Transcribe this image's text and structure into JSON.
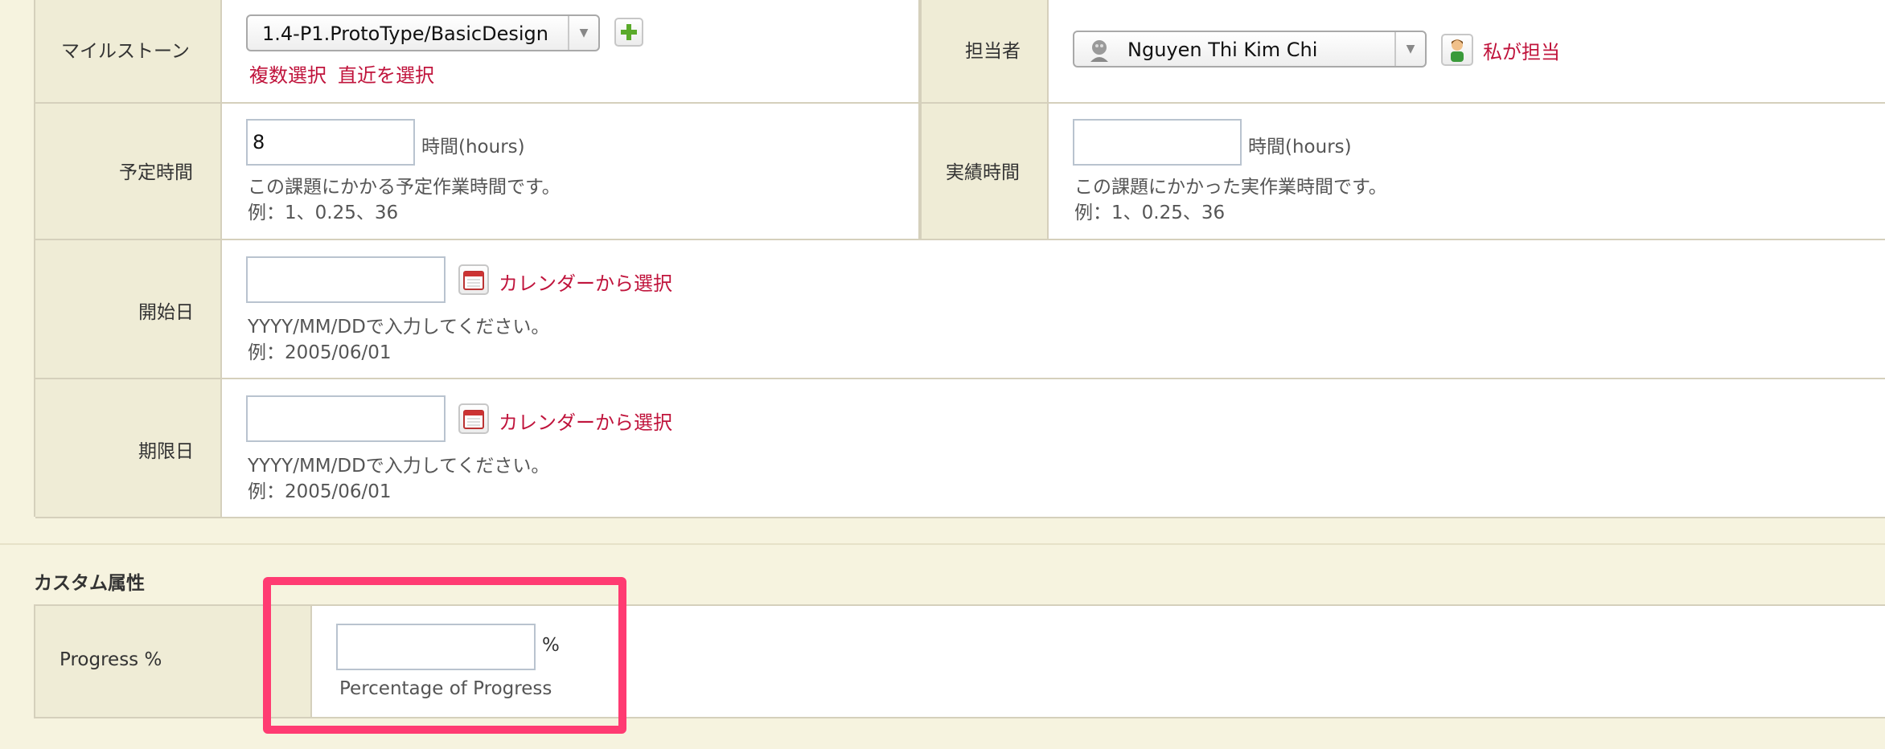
{
  "milestone": {
    "label": "マイルストーン",
    "value": "1.4-P1.ProtoType/BasicDesign",
    "link_multi": "複数選択",
    "link_recent": "直近を選択"
  },
  "assignee": {
    "label": "担当者",
    "value": "Nguyen Thi Kim Chi",
    "self_assign": "私が担当"
  },
  "estimated": {
    "label": "予定時間",
    "value": "8",
    "unit": "時間(hours)",
    "help1": "この課題にかかる予定作業時間です。",
    "help2": "例：1、0.25、36"
  },
  "actual": {
    "label": "実績時間",
    "value": "",
    "unit": "時間(hours)",
    "help1": "この課題にかかった実作業時間です。",
    "help2": "例：1、0.25、36"
  },
  "start_date": {
    "label": "開始日",
    "value": "",
    "calendar_link": "カレンダーから選択",
    "help1": "YYYY/MM/DDで入力してください。",
    "help2": "例：2005/06/01"
  },
  "due_date": {
    "label": "期限日",
    "value": "",
    "calendar_link": "カレンダーから選択",
    "help1": "YYYY/MM/DDで入力してください。",
    "help2": "例：2005/06/01"
  },
  "custom": {
    "heading": "カスタム属性",
    "progress_label": "Progress %",
    "progress_value": "",
    "progress_unit": "%",
    "progress_help": "Percentage of Progress"
  },
  "colors": {
    "highlight": "#ff3b72",
    "link": "#c0143c",
    "label_bg": "#efecd6",
    "page_bg": "#f6f3df"
  }
}
